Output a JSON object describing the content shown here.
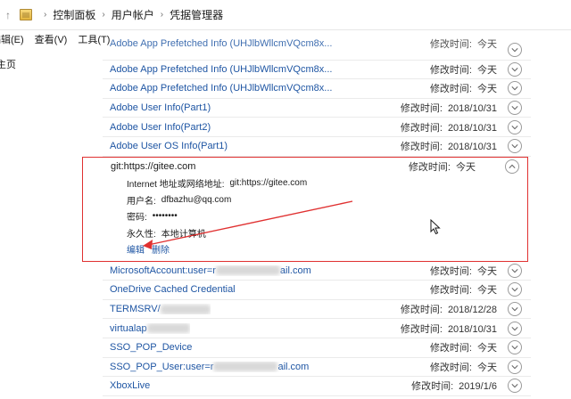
{
  "address": {
    "crumbs": [
      "控制面板",
      "用户帐户",
      "凭据管理器"
    ]
  },
  "menu": {
    "items": [
      "编辑(E)",
      "查看(V)",
      "工具(T)"
    ]
  },
  "left_pane": {
    "home_label": "主页"
  },
  "list": {
    "modified_label": "修改时间:",
    "rows_before": [
      {
        "name": "Adobe App Prefetched Info (UHJlbWllcmVQcm8x...",
        "date": "今天"
      },
      {
        "name": "Adobe App Prefetched Info (UHJlbWllcmVQcm8x...",
        "date": "今天"
      },
      {
        "name": "Adobe App Prefetched Info (UHJlbWllcmVQcm8x...",
        "date": "今天"
      },
      {
        "name": "Adobe User Info(Part1)",
        "date": "2018/10/31"
      },
      {
        "name": "Adobe User Info(Part2)",
        "date": "2018/10/31"
      },
      {
        "name": "Adobe User OS Info(Part1)",
        "date": "2018/10/31"
      }
    ],
    "expanded": {
      "name": "git:https://gitee.com",
      "date": "今天",
      "address_label": "Internet 地址或网络地址:",
      "address_value": "git:https://gitee.com",
      "user_label": "用户名:",
      "user_value": "dfbazhu@qq.com",
      "password_label": "密码:",
      "password_value": "••••••••",
      "persistence_label": "永久性:",
      "persistence_value": "本地计算机",
      "edit_label": "编辑",
      "delete_label": "删除"
    },
    "rows_after": [
      {
        "name_a": "MicrosoftAccount:user=r",
        "name_b": "ail.com",
        "date": "今天"
      },
      {
        "name_a": "OneDrive Cached Credential",
        "name_b": "",
        "date": "今天"
      },
      {
        "name_a": "TERMSRV/",
        "name_b": "",
        "date": "2018/12/28"
      },
      {
        "name_a": "virtualap",
        "name_b": "",
        "date": "2018/10/31"
      },
      {
        "name_a": "SSO_POP_Device",
        "name_b": "",
        "date": "今天"
      },
      {
        "name_a": "SSO_POP_User:user=r",
        "name_b": "ail.com",
        "date": "今天"
      },
      {
        "name_a": "XboxLive",
        "name_b": "",
        "date": "2019/1/6"
      }
    ]
  },
  "colors": {
    "link": "#1e55a3",
    "highlight_border": "#e03131",
    "annotation_arrow": "#e03131"
  }
}
